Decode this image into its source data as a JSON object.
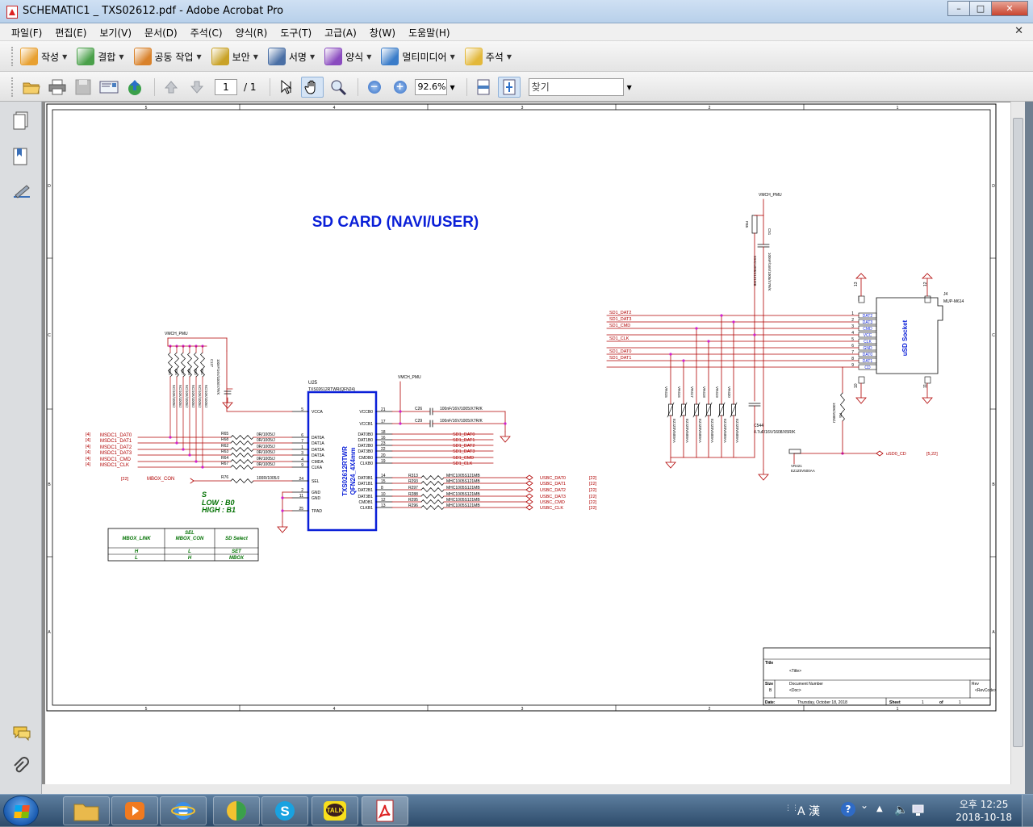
{
  "window": {
    "title": "SCHEMATIC1 _ TXS02612.pdf - Adobe Acrobat Pro"
  },
  "menu": [
    "파일(F)",
    "편집(E)",
    "보기(V)",
    "문서(D)",
    "주석(C)",
    "양식(R)",
    "도구(T)",
    "고급(A)",
    "창(W)",
    "도움말(H)"
  ],
  "toolbar_tasks": [
    {
      "label": "작성",
      "icon": "create-icon",
      "color": "#e8a030"
    },
    {
      "label": "결합",
      "icon": "combine-icon",
      "color": "#4aa04a"
    },
    {
      "label": "공동 작업",
      "icon": "collaborate-icon",
      "color": "#d9822b"
    },
    {
      "label": "보안",
      "icon": "lock-icon",
      "color": "#c9a227"
    },
    {
      "label": "서명",
      "icon": "pen-icon",
      "color": "#4a6fa5"
    },
    {
      "label": "양식",
      "icon": "form-icon",
      "color": "#8a4bbf"
    },
    {
      "label": "멀티미디어",
      "icon": "multimedia-icon",
      "color": "#3a7cc9"
    },
    {
      "label": "주석",
      "icon": "comment-icon",
      "color": "#e3b83a"
    }
  ],
  "toolbar": {
    "page_current": "1",
    "page_total": "/ 1",
    "zoom": "92.6%",
    "find_placeholder": "찾기"
  },
  "schematic": {
    "title": "SD CARD (NAVI/USER)",
    "border_cols_top": [
      "5",
      "4",
      "3",
      "2",
      "1"
    ],
    "border_rows": [
      "D",
      "C",
      "B",
      "A"
    ],
    "ic": {
      "ref": "U25",
      "part": "TXS02612RTWR(QFN24)",
      "body_line1": "TXS02612RTWR",
      "body_line2": "QFN24_4X4mm"
    },
    "ic_left_pins": [
      {
        "num": "5",
        "name": "VCCA"
      },
      {
        "num": "6",
        "name": "DAT0A"
      },
      {
        "num": "7",
        "name": "DAT1A"
      },
      {
        "num": "1",
        "name": "DAT2A"
      },
      {
        "num": "3",
        "name": "DAT3A"
      },
      {
        "num": "4",
        "name": "CMDA"
      },
      {
        "num": "9",
        "name": "CLKA"
      },
      {
        "num": "24",
        "name": "SEL"
      },
      {
        "num": "2",
        "name": "GND"
      },
      {
        "num": "11",
        "name": "GND"
      },
      {
        "num": "25",
        "name": "TPAD"
      }
    ],
    "ic_right_pins": [
      {
        "num": "21",
        "name": "VCCB0"
      },
      {
        "num": "17",
        "name": "VCCB1"
      },
      {
        "num": "18",
        "name": "DAT0B0"
      },
      {
        "num": "16",
        "name": "DAT1B0"
      },
      {
        "num": "23",
        "name": "DAT2B0"
      },
      {
        "num": "22",
        "name": "DAT3B0"
      },
      {
        "num": "20",
        "name": "CMDB0"
      },
      {
        "num": "19",
        "name": "CLKB0"
      },
      {
        "num": "14",
        "name": "DAT0B1"
      },
      {
        "num": "15",
        "name": "DAT1B1"
      },
      {
        "num": "8",
        "name": "DAT2B1"
      },
      {
        "num": "10",
        "name": "DAT3B1"
      },
      {
        "num": "12",
        "name": "CMDB1"
      },
      {
        "num": "13",
        "name": "CLKB1"
      }
    ],
    "left_nets": [
      {
        "page": "[4]",
        "net": "MSDC1_DAT0",
        "res": "R65",
        "val": "0R/1005/J"
      },
      {
        "page": "[4]",
        "net": "MSDC1_DAT1",
        "res": "R68",
        "val": "0R/1005/J"
      },
      {
        "page": "[4]",
        "net": "MSDC1_DAT2",
        "res": "R62",
        "val": "0R/1005/J"
      },
      {
        "page": "[4]",
        "net": "MSDC1_DAT3",
        "res": "R63",
        "val": "0R/1005/J"
      },
      {
        "page": "[4]",
        "net": "MSDC1_CMD",
        "res": "R64",
        "val": "0R/1005/J"
      },
      {
        "page": "[4]",
        "net": "MSDC1_CLK",
        "res": "R67",
        "val": "0R/1005/J"
      }
    ],
    "mbox": {
      "page": "[22]",
      "net": "MBOX_CON",
      "res": "R76",
      "val": "100R/1005/J"
    },
    "sd1_nets": [
      "SD1_DAT0",
      "SD1_DAT1",
      "SD1_DAT2",
      "SD1_DAT3",
      "SD1_CMD",
      "SD1_CLK"
    ],
    "usbc_nets": [
      {
        "res": "R313",
        "part": "MHC1005S121MB",
        "net": "USBC_DAT0",
        "page": "[22]"
      },
      {
        "res": "R293",
        "part": "MHC1005S121MB",
        "net": "USBC_DAT1",
        "page": "[22]"
      },
      {
        "res": "R297",
        "part": "MHC1005S121MB",
        "net": "USBC_DAT2",
        "page": "[22]"
      },
      {
        "res": "R288",
        "part": "MHC1005S121MB",
        "net": "USBC_DAT3",
        "page": "[22]"
      },
      {
        "res": "R295",
        "part": "MHC1005S121MB",
        "net": "USBC_CMD",
        "page": "[22]"
      },
      {
        "res": "R296",
        "part": "MHC1005S121MB",
        "net": "USBC_CLK",
        "page": "[22]"
      }
    ],
    "caps": [
      {
        "ref": "C26",
        "val": "100nF/16V/1005/X7R/K"
      },
      {
        "ref": "C29",
        "val": "100nF/16V/1005/X7R/K"
      }
    ],
    "pullup_label": "NC/10K/1005/J",
    "pullup_cap": "100nF/16V/1005/X7R/K",
    "pullup_cap_ref": "C127",
    "pullup_res": [
      "R55",
      "R56",
      "R57",
      "R59",
      "R60",
      "R61"
    ],
    "vmch_labels": [
      "VMCH_PMU",
      "VMCH_PMU",
      "VMCH_PMU"
    ],
    "sel_note": {
      "line1": "S",
      "line2": "LOW : B0",
      "line3": "HIGH : B1"
    },
    "sel_table": {
      "headers": [
        "MBOX_LINK",
        "SEL\nMBOX_CON",
        "SD Select"
      ],
      "rows": [
        [
          "H",
          "L",
          "SET"
        ],
        [
          "L",
          "H",
          "MBOX"
        ]
      ]
    },
    "socket": {
      "ref": "J4",
      "part": "MUP-M614",
      "label": "uSD Socket",
      "pins": [
        "DAT2",
        "DAT3",
        "CMD",
        "VCC",
        "CLK",
        "GND",
        "DAT0",
        "DAT1",
        "CD"
      ],
      "pin_nums": [
        "1",
        "2",
        "3",
        "4",
        "5",
        "6",
        "7",
        "8",
        "9"
      ],
      "gnd_pins": [
        "13",
        "12",
        "10",
        "11"
      ]
    },
    "socket_nets": [
      "SD1_DAT2",
      "SD1_DAT3",
      "SD1_CMD",
      "SD1_CLK",
      "SD1_DAT0",
      "SD1_DAT1"
    ],
    "varistors": [
      "VR415",
      "VR416",
      "VR417",
      "VR418",
      "VR419",
      "VR420"
    ],
    "varistor_val": "EZJZ0V500AA",
    "fb": {
      "ref": "FB5",
      "val": "MHC1005S121MB"
    },
    "c_top": {
      "ref": "C51",
      "val": "100nF/16V/1005/X7R/K"
    },
    "c544": {
      "ref": "C544",
      "val": "4.7uF/16V/1608/X5R/K"
    },
    "vr421": {
      "ref": "VR421",
      "val": "EZJZ0V500AA"
    },
    "r_cd": {
      "ref": "R5",
      "val": "100K/1005/J"
    },
    "usd_cd": {
      "net": "uSD0_CD",
      "page": "[5,22]"
    },
    "title_block": {
      "title_label": "Title",
      "title": "<Title>",
      "size_label": "Size",
      "size": "B",
      "docnum_label": "Document Number",
      "docnum": "<Doc>",
      "rev_label": "Rev",
      "rev": "<RevCode>",
      "date_label": "Date:",
      "date": "Thursday, October 18, 2018",
      "sheet_label": "Sheet",
      "sheet": "1",
      "of_label": "of",
      "of": "1"
    }
  },
  "taskbar": {
    "lang": "A 漢",
    "time": "오후 12:25",
    "date": "2018-10-18"
  }
}
